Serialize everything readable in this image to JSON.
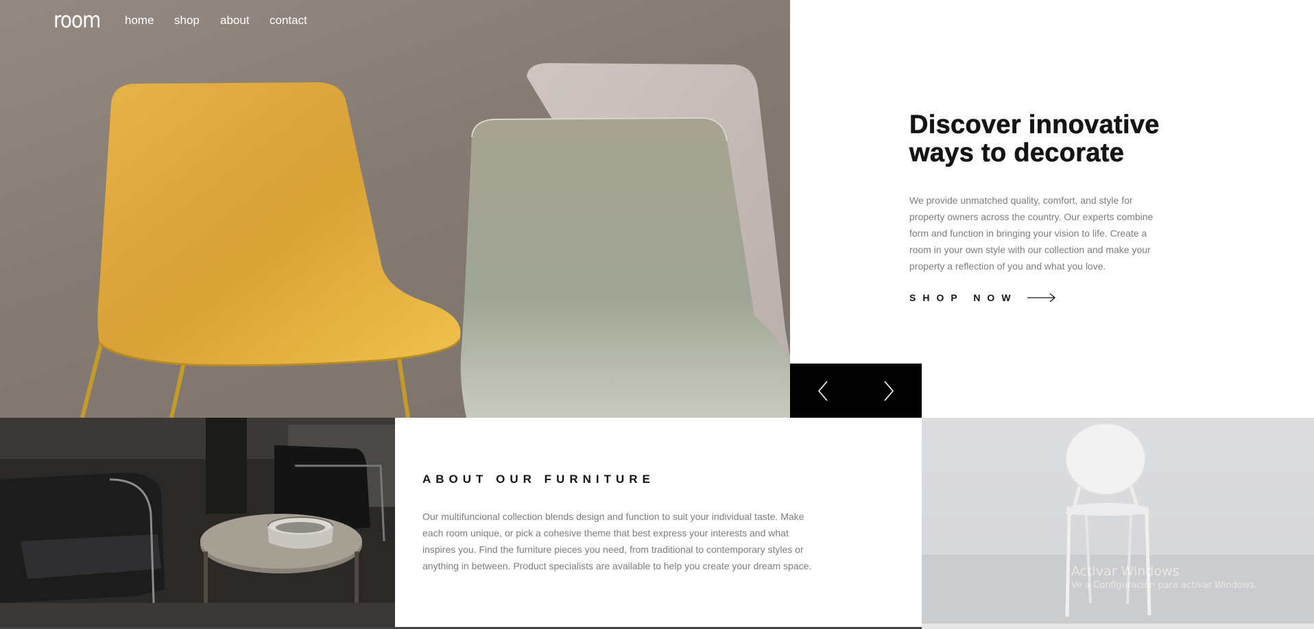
{
  "nav": {
    "logo": "room",
    "links": [
      "home",
      "shop",
      "about",
      "contact"
    ]
  },
  "hero": {
    "title_line1": "Discover innovative",
    "title_line2": "ways to decorate",
    "description": "We provide unmatched quality, comfort, and style for property owners across the country. Our experts combine form and function in bringing your vision to life. Create a room in your own style with our collection and make your property a reflection of you and what you love.",
    "cta_label": "SHOP NOW"
  },
  "about": {
    "title": "ABOUT OUR FURNITURE",
    "description": "Our multifuncional collection blends design and function to suit your individual taste. Make each room unique, or pick a cohesive theme that best express your interests and what inspires you. Find the furniture pieces you need, from traditional to contemporary styles or anything in between. Product specialists are available to help you create your dream space."
  },
  "watermark": {
    "title": "Activar Windows",
    "subtitle": "Ve a Configuración para activar Windows."
  },
  "colors": {
    "text_dark": "#141414",
    "text_muted": "#7d7d7d",
    "slider_bg": "#000000"
  },
  "icons": [
    "arrow-right-icon",
    "chevron-left-icon",
    "chevron-right-icon"
  ]
}
